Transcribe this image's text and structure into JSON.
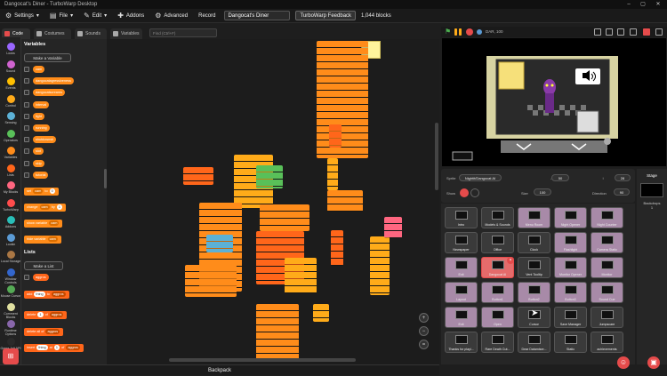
{
  "window": {
    "title": "Dangocat's Diner - TurboWarp Desktop"
  },
  "menu": {
    "settings": "Settings",
    "file": "File",
    "edit": "Edit",
    "addons": "Addons",
    "advanced": "Advanced",
    "record": "Record",
    "project_title": "Dangocat's Diner",
    "feedback": "TurboWarp Feedback",
    "blocks_count": "1,044 blocks"
  },
  "tabs": [
    {
      "label": "Code",
      "icon": "code-icon",
      "active": true
    },
    {
      "label": "Costumes",
      "icon": "brush-icon",
      "active": false
    },
    {
      "label": "Sounds",
      "icon": "speaker-icon",
      "active": false
    },
    {
      "label": "Variables",
      "icon": "variables-icon",
      "active": false
    }
  ],
  "find_placeholder": "Find (Ctrl+F)",
  "categories": [
    {
      "label": "Looks",
      "color": "#9966ff"
    },
    {
      "label": "Sound",
      "color": "#cf63cf"
    },
    {
      "label": "Events",
      "color": "#ffbf00"
    },
    {
      "label": "Control",
      "color": "#ffab19"
    },
    {
      "label": "Sensing",
      "color": "#5cb1d6"
    },
    {
      "label": "Operators",
      "color": "#59c059"
    },
    {
      "label": "Variables",
      "color": "#ff8c1a"
    },
    {
      "label": "Lists",
      "color": "#ff661a"
    },
    {
      "label": "My Blocks",
      "color": "#ff6680"
    },
    {
      "label": "TurboWarp",
      "color": "#ff4c4c"
    },
    {
      "label": "Addons",
      "color": "#29beb8"
    },
    {
      "label": "Lookin",
      "color": "#5b9bd5"
    },
    {
      "label": "Local Storage",
      "color": "#aa7744"
    },
    {
      "label": "Window Controls",
      "color": "#3366cc"
    },
    {
      "label": "Mouse Cursor",
      "color": "#55aa55"
    },
    {
      "label": "Comment Blocks",
      "color": "#e0e0a0"
    },
    {
      "label": "Runtime Options",
      "color": "#8866aa"
    },
    {
      "label": "Game Jolt API",
      "color": "#2a2a2a"
    }
  ],
  "palette": {
    "variables_heading": "Variables",
    "make_variable": "Make a Variable",
    "variables": [
      "cam",
      "dangocatagressiveness",
      "dangocatscreams",
      "interval",
      "light",
      "running",
      "shutdownsh",
      "slot",
      "skip",
      "tutorial"
    ],
    "set_block": {
      "prefix": "set",
      "var": "cam",
      "to": "to",
      "value": "0"
    },
    "change_block": {
      "prefix": "change",
      "var": "cam",
      "by": "by",
      "value": "1"
    },
    "show_block": {
      "prefix": "show variable",
      "var": "cam"
    },
    "hide_block": {
      "prefix": "hide variable",
      "var": "cam"
    },
    "lists_heading": "Lists",
    "make_list": "Make a List",
    "lists": [
      "aggros"
    ],
    "add_block": {
      "prefix": "add",
      "item": "thing",
      "to": "to",
      "list": "aggros"
    },
    "delete_block": {
      "prefix": "delete",
      "index": "1",
      "of": "of",
      "list": "aggros"
    },
    "delete_all_block": {
      "prefix": "delete all of",
      "list": "aggros"
    },
    "insert_block": {
      "prefix": "insert",
      "item": "thing",
      "at": "at",
      "index": "1",
      "of": "of",
      "list": "aggros"
    }
  },
  "backpack": "Backpack",
  "stage_controls": {
    "fps_readout": "DAR, 100"
  },
  "sprite_info": {
    "sprite_label": "Sprite",
    "sprite_name": "Nightit/Dangocat AI",
    "x_value": "50",
    "y_value": "28",
    "show_label": "Show",
    "size_label": "Size",
    "size_value": "100",
    "direction_label": "Direction",
    "direction_value": "90"
  },
  "sprites": [
    {
      "name": "Intro"
    },
    {
      "name": "Models & Sounds"
    },
    {
      "name": "Menu Room"
    },
    {
      "name": "Night Opener"
    },
    {
      "name": "Night Counter"
    },
    {
      "name": "Newspaper"
    },
    {
      "name": "Office"
    },
    {
      "name": "Clock"
    },
    {
      "name": "Flashlight"
    },
    {
      "name": "Camera Static"
    },
    {
      "name": "Exit"
    },
    {
      "name": "Dangocat AI",
      "selected": true
    },
    {
      "name": "Vent Tooltip"
    },
    {
      "name": "Monitor Opener"
    },
    {
      "name": "Monitor"
    },
    {
      "name": "Layout"
    },
    {
      "name": "Button1"
    },
    {
      "name": "Button2"
    },
    {
      "name": "Button3"
    },
    {
      "name": "Sound Cue"
    },
    {
      "name": "Exit"
    },
    {
      "name": "Open"
    },
    {
      "name": "Cursor"
    },
    {
      "name": "Save Manager"
    },
    {
      "name": "Jumpscare"
    },
    {
      "name": "Thanks for playi..."
    },
    {
      "name": "Rare Death Cut..."
    },
    {
      "name": "Dear Datamiser..."
    },
    {
      "name": "Static"
    },
    {
      "name": "achievements"
    }
  ],
  "stage_pane": {
    "label": "Stage",
    "backdrops_label": "Backdrops",
    "backdrops_count": "1"
  },
  "colors": {
    "accent": "#e54b4b",
    "variables": "#ff8c1a",
    "lists": "#ff661a"
  }
}
